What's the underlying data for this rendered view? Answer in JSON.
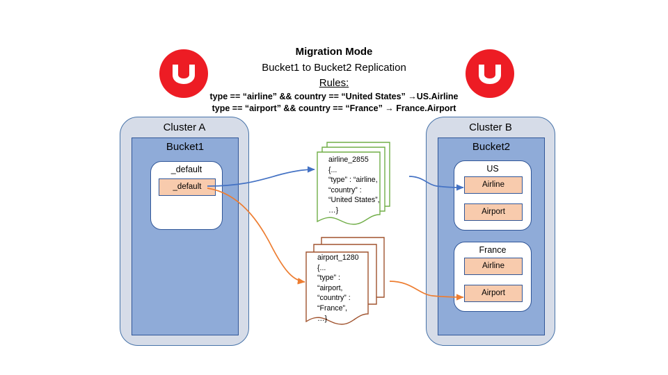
{
  "header": {
    "title": "Migration Mode",
    "subtitle": "Bucket1 to Bucket2 Replication",
    "rules_label": "Rules:",
    "rules": [
      "type == “airline” && country == “United States” →US.Airline",
      "type == “airport” && country == “France” → France.Airport"
    ]
  },
  "logos": {
    "left": "couchbase-logo",
    "right": "couchbase-logo"
  },
  "source": {
    "cluster_label": "Cluster A",
    "bucket_label": "Bucket1",
    "scopes": [
      {
        "label": "_default",
        "collections": [
          {
            "label": "_default"
          }
        ]
      }
    ]
  },
  "target": {
    "cluster_label": "Cluster B",
    "bucket_label": "Bucket2",
    "scopes": [
      {
        "label": "US",
        "collections": [
          {
            "label": "Airline"
          },
          {
            "label": "Airport"
          }
        ]
      },
      {
        "label": "France",
        "collections": [
          {
            "label": "Airline"
          },
          {
            "label": "Airport"
          }
        ]
      }
    ]
  },
  "documents": [
    {
      "id": "airline-document-stack",
      "key": "airline_2855",
      "body": "{...\n“type” : “airline,\n“country” :\n“United States”,\n…}",
      "color": "#70ad47"
    },
    {
      "id": "airport-document-stack",
      "key": "airport_1280",
      "body": "{...\n“type” :\n“airport,\n“country” :\n“France”,\n…}",
      "color": "#a0522d"
    }
  ],
  "connectors": [
    {
      "id": "airline-flow",
      "color": "#4472c4"
    },
    {
      "id": "airport-flow",
      "color": "#ed7d31"
    }
  ],
  "colors": {
    "cluster_fill": "#d6dce8",
    "cluster_border": "#4672a8",
    "bucket_fill": "#8fabd8",
    "bucket_border": "#2f5597",
    "scope_fill": "#ffffff",
    "collection_fill": "#f8cbad",
    "collection_border": "#2f5597",
    "logo_red": "#ed1c24",
    "arrow_blue": "#4472c4",
    "arrow_orange": "#ed7d31",
    "doc_green": "#70ad47",
    "doc_brown": "#a0522d"
  }
}
